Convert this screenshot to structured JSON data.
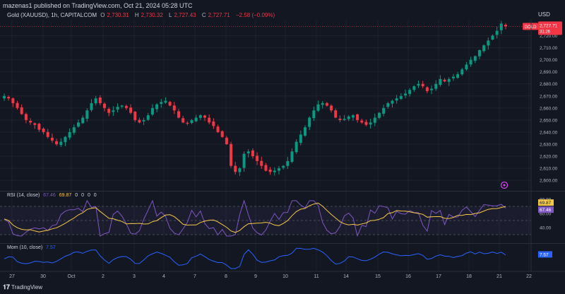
{
  "header": {
    "publisher": "mazenas1 published on TradingView.com, Oct 21, 2024 05:28 UTC",
    "symbol": "Gold (XAUUSD), 1h, CAPITALCOM",
    "ohlc": [
      {
        "label": "O",
        "value": "2,730.31"
      },
      {
        "label": "H",
        "value": "2,730.32"
      },
      {
        "label": "L",
        "value": "2,727.43"
      },
      {
        "label": "C",
        "value": "2,727.71"
      },
      {
        "label": "",
        "value": "−2.58 (−0.09%)"
      }
    ],
    "currency": "USD"
  },
  "price_tag": {
    "symbol": "GOLD",
    "price": "2,727.71",
    "countdown": "31:26"
  },
  "price_axis_labels": [
    "2,720.00",
    "2,710.00",
    "2,700.00",
    "2,690.00",
    "2,680.00",
    "2,670.00",
    "2,660.00",
    "2,650.00",
    "2,640.00",
    "2,630.00",
    "2,620.00",
    "2,610.00",
    "2,600.00"
  ],
  "rsi_panel": {
    "title": "RSI (14, close)",
    "legend_values": [
      "67.46",
      "69.87",
      "0",
      "0",
      "0",
      "0"
    ],
    "axis_labels": [
      "80.00",
      "60.00",
      "40.00"
    ],
    "tags": {
      "rsi": "67.46",
      "ma": "69.87"
    }
  },
  "mom_panel": {
    "title": "Mom (10, close)",
    "legend_value": "7.57",
    "tag": "7.57"
  },
  "time_axis_labels": [
    "27",
    "30",
    "Oct",
    "2",
    "3",
    "4",
    "7",
    "8",
    "9",
    "10",
    "11",
    "14",
    "15",
    "16",
    "17",
    "18",
    "21",
    "22"
  ],
  "footer": {
    "brand": "TradingView"
  },
  "colors": {
    "bg": "#131722",
    "up": "#089981",
    "down": "#f23645",
    "rsi": "#7e57c2",
    "rsi_ma": "#f7c948",
    "mom": "#2962ff",
    "grid": "#2a2e39"
  },
  "chart_data": [
    {
      "type": "candlestick",
      "title": "Gold (XAUUSD), 1h, CAPITALCOM",
      "ylim": [
        2596,
        2732
      ],
      "y_ticks": [
        2720,
        2710,
        2700,
        2690,
        2680,
        2670,
        2660,
        2650,
        2640,
        2630,
        2620,
        2610,
        2600
      ],
      "x_labels": [
        "27",
        "30",
        "Oct",
        "2",
        "3",
        "4",
        "7",
        "8",
        "9",
        "10",
        "11",
        "14",
        "15",
        "16",
        "17",
        "18",
        "21",
        "22"
      ],
      "close_path_approx": [
        2670,
        2668,
        2664,
        2660,
        2655,
        2650,
        2648,
        2646,
        2642,
        2640,
        2636,
        2633,
        2630,
        2632,
        2636,
        2640,
        2644,
        2648,
        2652,
        2658,
        2664,
        2668,
        2664,
        2660,
        2656,
        2658,
        2661,
        2662,
        2660,
        2656,
        2650,
        2648,
        2650,
        2654,
        2660,
        2663,
        2665,
        2666,
        2662,
        2658,
        2652,
        2648,
        2647,
        2650,
        2652,
        2654,
        2652,
        2648,
        2645,
        2640,
        2636,
        2630,
        2612,
        2607,
        2610,
        2622,
        2624,
        2620,
        2616,
        2612,
        2608,
        2607,
        2608,
        2610,
        2612,
        2616,
        2624,
        2632,
        2638,
        2644,
        2652,
        2658,
        2663,
        2664,
        2662,
        2658,
        2652,
        2650,
        2651,
        2653,
        2654,
        2650,
        2648,
        2646,
        2648,
        2652,
        2656,
        2660,
        2664,
        2666,
        2668,
        2670,
        2672,
        2675,
        2678,
        2680,
        2678,
        2674,
        2676,
        2680,
        2684,
        2682,
        2684,
        2686,
        2688,
        2692,
        2696,
        2700,
        2703,
        2708,
        2712,
        2716,
        2720,
        2724,
        2730,
        2727.71
      ]
    },
    {
      "type": "line",
      "title": "RSI (14, close)",
      "ylim": [
        20,
        90
      ],
      "series": [
        {
          "name": "RSI",
          "last": 67.46
        },
        {
          "name": "MA",
          "last": 69.87
        }
      ]
    },
    {
      "type": "line",
      "title": "Mom (10, close)",
      "series": [
        {
          "name": "Mom",
          "last": 7.57
        }
      ]
    }
  ]
}
